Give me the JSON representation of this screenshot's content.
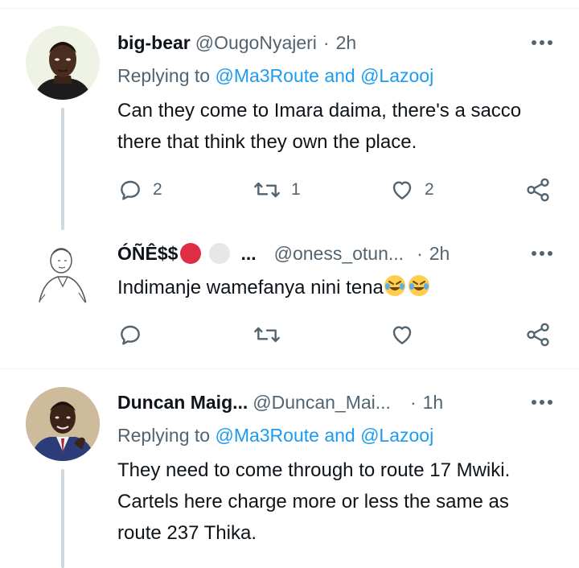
{
  "tweets": [
    {
      "name": "big-bear",
      "handle": "@OugoNyajeri",
      "time": "2h",
      "replying_prefix": "Replying to",
      "replying_to": "@Ma3Route and @Lazooj",
      "text": "Can they come to Imara daima, there's a sacco there that think they own the place.",
      "replies": "2",
      "retweets": "1",
      "likes": "2"
    },
    {
      "name": "ÓÑÊ$$",
      "name_ellipsis": "...",
      "handle": "@oness_otun...",
      "time": "2h",
      "text": "Indimanje wamefanya nini tena",
      "emoji_icons": [
        "rolling-on-floor-laughing-icon",
        "rolling-on-floor-laughing-icon"
      ]
    },
    {
      "name": "Duncan Maig...",
      "handle": "@Duncan_Mai...",
      "time": "1h",
      "replying_prefix": "Replying to",
      "replying_to": "@Ma3Route and @Lazooj",
      "text": "They need to come through to route 17 Mwiki. Cartels here charge more or less the same as route 237 Thika."
    }
  ],
  "dot_separator": "·",
  "colors": {
    "text": "#0f1419",
    "secondary": "#536471",
    "link": "#1d9bf0",
    "thread_line": "#cfd9de",
    "divider": "#eff3f4"
  }
}
